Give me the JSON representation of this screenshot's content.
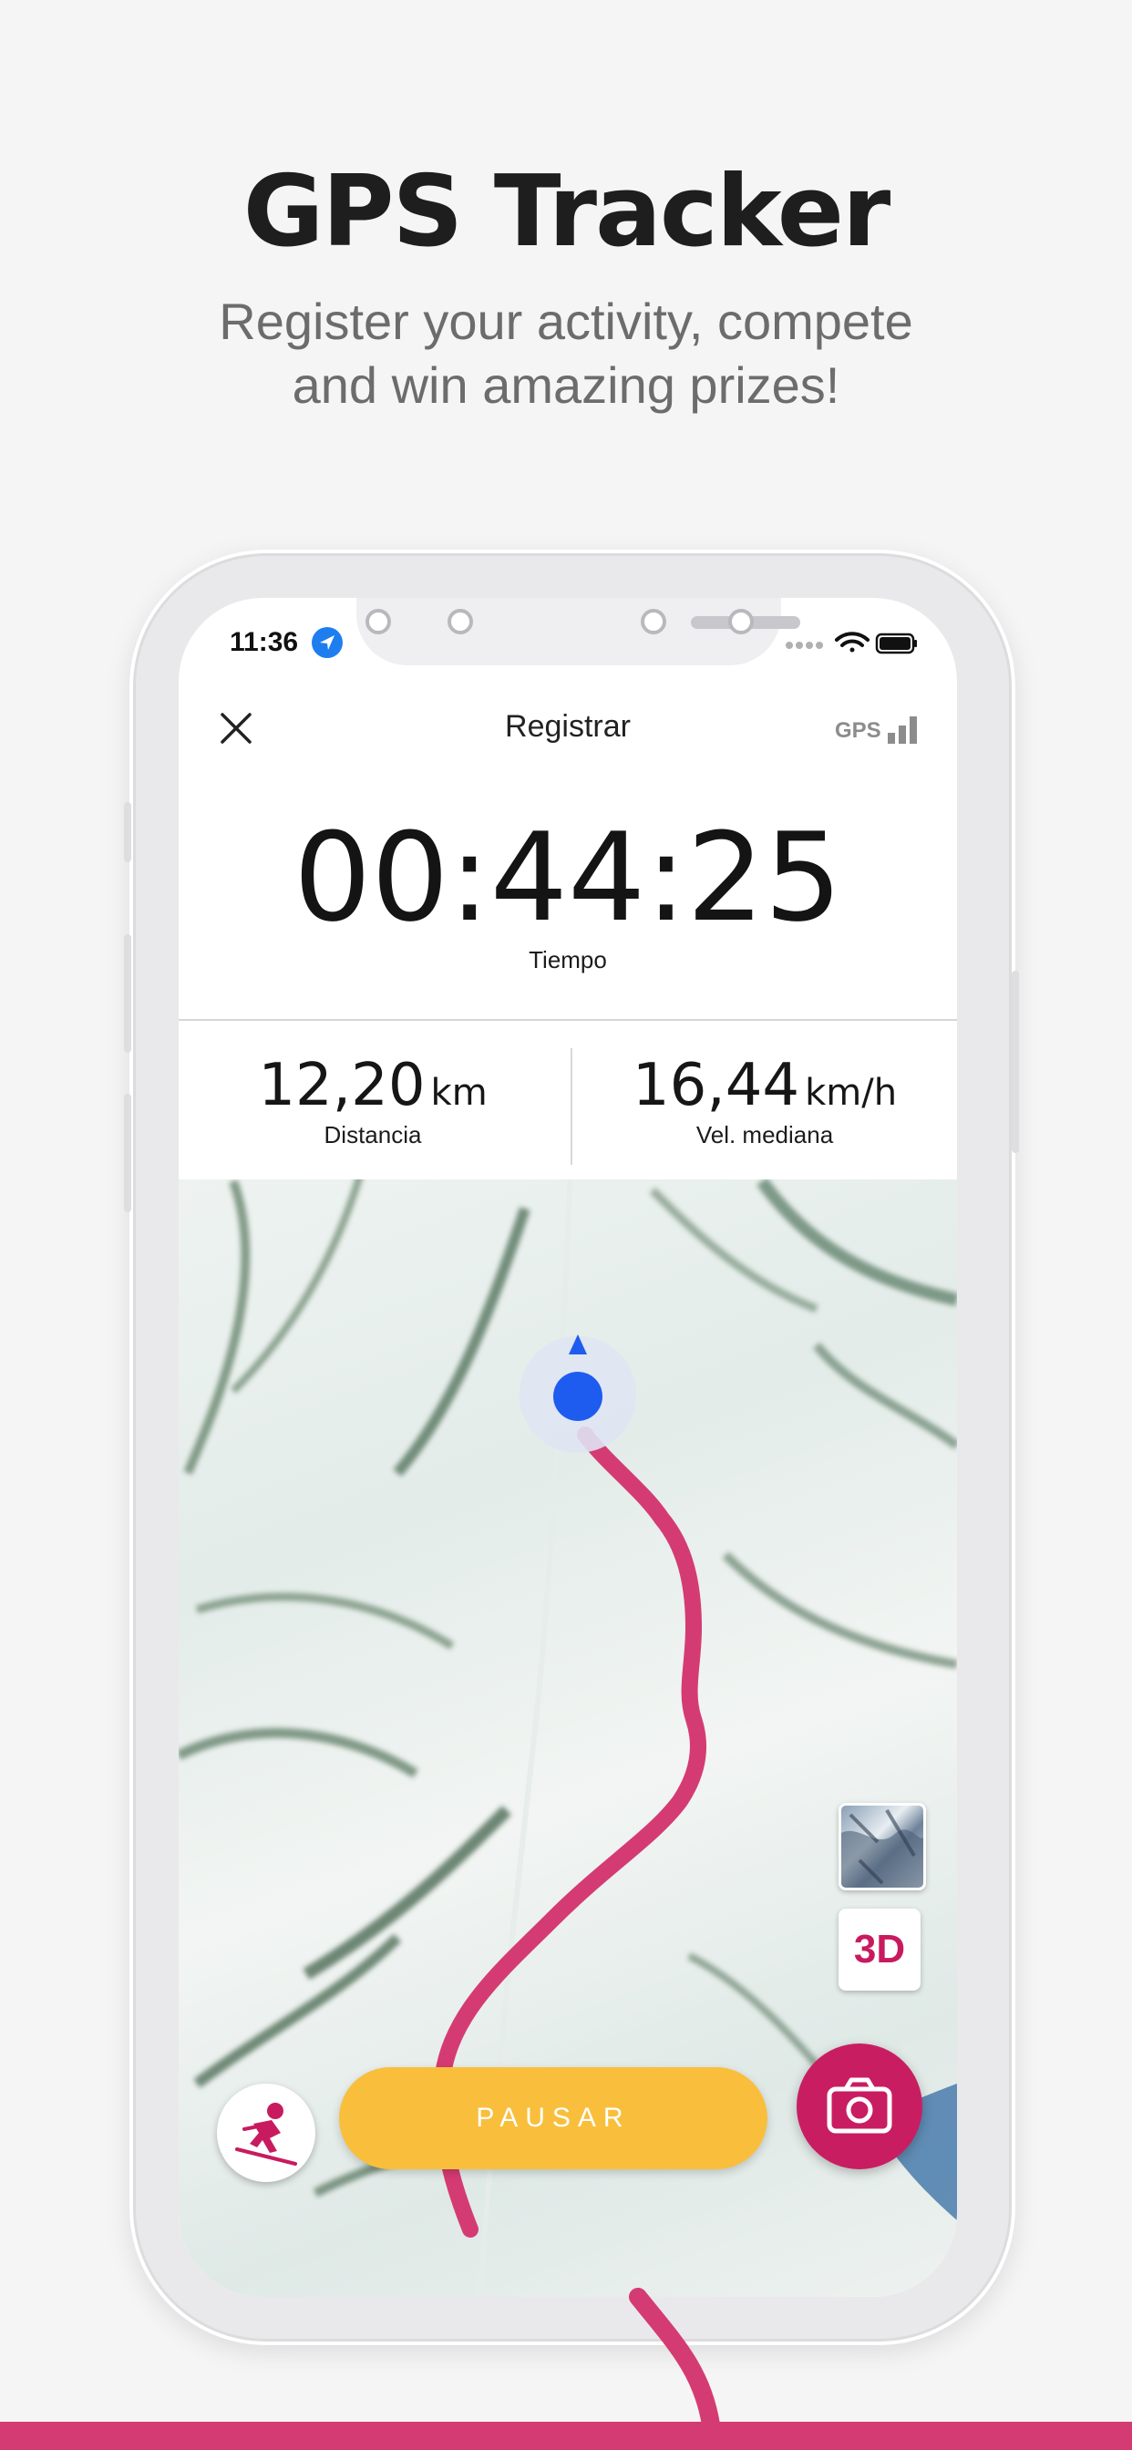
{
  "promo": {
    "title": "GPS Tracker",
    "subtitle_line1": "Register your activity, compete",
    "subtitle_line2": "and win amazing prizes!"
  },
  "status_bar": {
    "time": "11:36"
  },
  "nav": {
    "title": "Registrar",
    "gps_label": "GPS"
  },
  "timer": {
    "value": "00:44:25",
    "label": "Tiempo"
  },
  "stats": {
    "distance": {
      "value": "12,20",
      "unit": "km",
      "label": "Distancia"
    },
    "avg_speed": {
      "value": "16,44",
      "unit": "km/h",
      "label": "Vel. mediana"
    }
  },
  "map_controls": {
    "three_d_label": "3D"
  },
  "actions": {
    "pause_label": "PAUSAR"
  },
  "colors": {
    "accent_pink": "#d53b73",
    "pause_yellow": "#f9bf3c",
    "location_blue": "#1e5cf0"
  },
  "icons": [
    "location-arrow-icon",
    "wifi-icon",
    "battery-icon",
    "close-icon",
    "signal-bars-icon",
    "skier-icon",
    "camera-icon",
    "map-layer-icon"
  ]
}
